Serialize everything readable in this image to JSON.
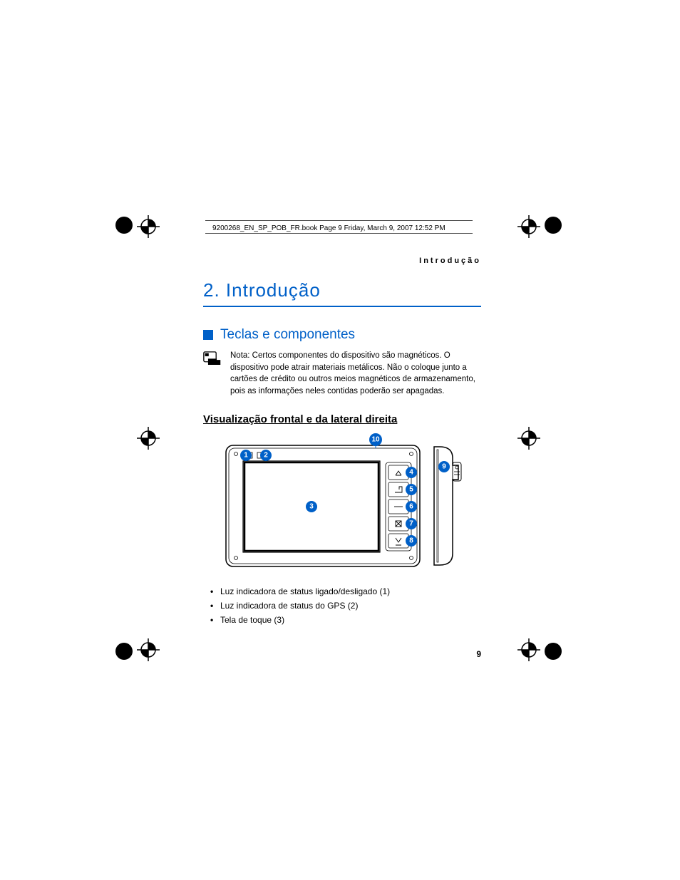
{
  "header": {
    "filename_line": "9200268_EN_SP_POB_FR.book  Page 9  Friday, March 9, 2007  12:52 PM"
  },
  "running_head": "Introdução",
  "chapter_title": "2.   Introdução",
  "section_title": "Teclas e componentes",
  "note_text": "Nota: Certos componentes do dispositivo são magnéticos. O dispositivo pode atrair materiais metálicos. Não o coloque junto a cartões de crédito ou outros meios magnéticos de armazenamento, pois as informações neles contidas poderão ser apagadas.",
  "subheading": "Visualização frontal e da lateral direita",
  "callouts": {
    "c1": "1",
    "c2": "2",
    "c3": "3",
    "c4": "4",
    "c5": "5",
    "c6": "6",
    "c7": "7",
    "c8": "8",
    "c9": "9",
    "c10": "10"
  },
  "bullets": [
    "Luz indicadora de status ligado/desligado (1)",
    "Luz indicadora de status do GPS (2)",
    "Tela de toque (3)"
  ],
  "page_number": "9"
}
